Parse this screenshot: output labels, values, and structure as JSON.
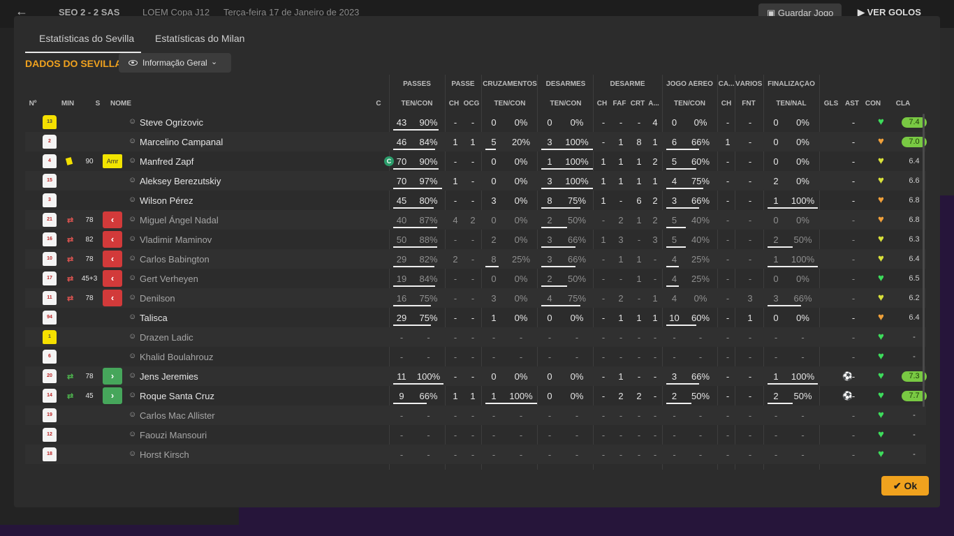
{
  "topbar": {
    "score": "SEO  2 - 2  SAS",
    "competition": "LOEM Copa J12",
    "date": "Terça-feira 17 de Janeiro de 2023",
    "save_label": "Guardar Jogo",
    "goals_label": "VER GOLOS"
  },
  "tabs": [
    {
      "label": "Estatísticas do Sevilla"
    },
    {
      "label": "Estatísticas do Milan"
    }
  ],
  "section": {
    "title": "DADOS DO SEVILLA",
    "filter": "Informação Geral"
  },
  "groups": [
    "PASSES",
    "PASSE",
    "CRUZAMENTOS",
    "DESARMES",
    "DESARME",
    "JOGO AÉREO",
    "CA...",
    "VÁRIOS",
    "FINALIZAÇÃO"
  ],
  "columns": [
    "Nº",
    "MIN",
    "S",
    "NOME",
    "C",
    "TEN/CON",
    "CH",
    "OCG",
    "TEN/CON",
    "TEN/CON",
    "CH",
    "FAF",
    "CRT",
    "A...",
    "TEN/CON",
    "CH",
    "FNT",
    "TEN/NAL",
    "GLS",
    "AST",
    "CON",
    "CLA"
  ],
  "players": [
    {
      "num": "13",
      "kit": "y",
      "min": "",
      "sub": "",
      "pos": "",
      "card": false,
      "capt": false,
      "name": "Steve Ogrizovic",
      "dim": false,
      "p_ten": "43",
      "p_pct": "90%",
      "pb": 90,
      "pa_ch": "-",
      "pa_ocg": "-",
      "cr_ten": "0",
      "cr_pct": "0%",
      "crb": 0,
      "de_ten": "0",
      "de_pct": "0%",
      "deb": 0,
      "ds_ch": "-",
      "ds_faf": "-",
      "ds_crt": "-",
      "ds_a": "4",
      "ja_ten": "0",
      "ja_pct": "0%",
      "jab": 0,
      "ca_ch": "-",
      "fnt": "-",
      "fi_ten": "0",
      "fi_pct": "0%",
      "fib": 0,
      "gls": "",
      "ast": "-",
      "con": "green",
      "cla": "7.4",
      "cla_hi": true
    },
    {
      "num": "2",
      "kit": "w",
      "min": "",
      "sub": "",
      "pos": "",
      "card": false,
      "capt": false,
      "name": "Marcelino Campanal",
      "dim": false,
      "p_ten": "46",
      "p_pct": "84%",
      "pb": 84,
      "pa_ch": "1",
      "pa_ocg": "1",
      "cr_ten": "5",
      "cr_pct": "20%",
      "crb": 20,
      "de_ten": "3",
      "de_pct": "100%",
      "deb": 100,
      "ds_ch": "-",
      "ds_faf": "1",
      "ds_crt": "8",
      "ds_a": "1",
      "ja_ten": "6",
      "ja_pct": "66%",
      "jab": 66,
      "ca_ch": "1",
      "fnt": "-",
      "fi_ten": "0",
      "fi_pct": "0%",
      "fib": 0,
      "gls": "",
      "ast": "-",
      "con": "orange",
      "cla": "7.0",
      "cla_hi": true
    },
    {
      "num": "4",
      "kit": "w",
      "min": "90",
      "sub": "",
      "pos": "Amr",
      "card": true,
      "capt": true,
      "name": "Manfred Zapf",
      "dim": false,
      "p_ten": "70",
      "p_pct": "90%",
      "pb": 90,
      "pa_ch": "-",
      "pa_ocg": "-",
      "cr_ten": "0",
      "cr_pct": "0%",
      "crb": 0,
      "de_ten": "1",
      "de_pct": "100%",
      "deb": 100,
      "ds_ch": "1",
      "ds_faf": "1",
      "ds_crt": "1",
      "ds_a": "2",
      "ja_ten": "5",
      "ja_pct": "60%",
      "jab": 60,
      "ca_ch": "-",
      "fnt": "-",
      "fi_ten": "0",
      "fi_pct": "0%",
      "fib": 0,
      "gls": "",
      "ast": "-",
      "con": "yellow",
      "cla": "6.4",
      "cla_hi": false
    },
    {
      "num": "15",
      "kit": "w",
      "min": "",
      "sub": "",
      "pos": "",
      "card": false,
      "capt": false,
      "name": "Aleksey Berezutskiy",
      "dim": false,
      "p_ten": "70",
      "p_pct": "97%",
      "pb": 97,
      "pa_ch": "1",
      "pa_ocg": "-",
      "cr_ten": "0",
      "cr_pct": "0%",
      "crb": 0,
      "de_ten": "3",
      "de_pct": "100%",
      "deb": 100,
      "ds_ch": "1",
      "ds_faf": "1",
      "ds_crt": "1",
      "ds_a": "1",
      "ja_ten": "4",
      "ja_pct": "75%",
      "jab": 75,
      "ca_ch": "-",
      "fnt": "-",
      "fi_ten": "2",
      "fi_pct": "0%",
      "fib": 0,
      "gls": "",
      "ast": "-",
      "con": "yellow",
      "cla": "6.6",
      "cla_hi": false
    },
    {
      "num": "3",
      "kit": "w",
      "min": "",
      "sub": "",
      "pos": "",
      "card": false,
      "capt": false,
      "name": "Wilson Pérez",
      "dim": false,
      "p_ten": "45",
      "p_pct": "80%",
      "pb": 80,
      "pa_ch": "-",
      "pa_ocg": "-",
      "cr_ten": "3",
      "cr_pct": "0%",
      "crb": 0,
      "de_ten": "8",
      "de_pct": "75%",
      "deb": 75,
      "ds_ch": "1",
      "ds_faf": "-",
      "ds_crt": "6",
      "ds_a": "2",
      "ja_ten": "3",
      "ja_pct": "66%",
      "jab": 66,
      "ca_ch": "-",
      "fnt": "-",
      "fi_ten": "1",
      "fi_pct": "100%",
      "fib": 100,
      "gls": "",
      "ast": "-",
      "con": "orange",
      "cla": "6.8",
      "cla_hi": false
    },
    {
      "num": "21",
      "kit": "w",
      "min": "78",
      "sub": "out",
      "pos": "",
      "card": false,
      "capt": false,
      "name": "Miguel Ángel Nadal",
      "dim": true,
      "p_ten": "40",
      "p_pct": "87%",
      "pb": 87,
      "pa_ch": "4",
      "pa_ocg": "2",
      "cr_ten": "0",
      "cr_pct": "0%",
      "crb": 0,
      "de_ten": "2",
      "de_pct": "50%",
      "deb": 50,
      "ds_ch": "-",
      "ds_faf": "2",
      "ds_crt": "1",
      "ds_a": "2",
      "ja_ten": "5",
      "ja_pct": "40%",
      "jab": 40,
      "ca_ch": "-",
      "fnt": "-",
      "fi_ten": "0",
      "fi_pct": "0%",
      "fib": 0,
      "gls": "",
      "ast": "-",
      "con": "orange",
      "cla": "6.8",
      "cla_hi": false
    },
    {
      "num": "16",
      "kit": "w",
      "min": "82",
      "sub": "out",
      "pos": "",
      "card": false,
      "capt": false,
      "name": "Vladimir Maminov",
      "dim": true,
      "p_ten": "50",
      "p_pct": "88%",
      "pb": 88,
      "pa_ch": "-",
      "pa_ocg": "-",
      "cr_ten": "2",
      "cr_pct": "0%",
      "crb": 0,
      "de_ten": "3",
      "de_pct": "66%",
      "deb": 66,
      "ds_ch": "1",
      "ds_faf": "3",
      "ds_crt": "-",
      "ds_a": "3",
      "ja_ten": "5",
      "ja_pct": "40%",
      "jab": 40,
      "ca_ch": "-",
      "fnt": "-",
      "fi_ten": "2",
      "fi_pct": "50%",
      "fib": 50,
      "gls": "",
      "ast": "-",
      "con": "yellow",
      "cla": "6.3",
      "cla_hi": false
    },
    {
      "num": "10",
      "kit": "w",
      "min": "78",
      "sub": "out",
      "pos": "",
      "card": false,
      "capt": false,
      "name": "Carlos Babington",
      "dim": true,
      "p_ten": "29",
      "p_pct": "82%",
      "pb": 82,
      "pa_ch": "2",
      "pa_ocg": "-",
      "cr_ten": "8",
      "cr_pct": "25%",
      "crb": 25,
      "de_ten": "3",
      "de_pct": "66%",
      "deb": 66,
      "ds_ch": "-",
      "ds_faf": "1",
      "ds_crt": "1",
      "ds_a": "-",
      "ja_ten": "4",
      "ja_pct": "25%",
      "jab": 25,
      "ca_ch": "-",
      "fnt": "-",
      "fi_ten": "1",
      "fi_pct": "100%",
      "fib": 100,
      "gls": "",
      "ast": "-",
      "con": "yellow",
      "cla": "6.4",
      "cla_hi": false
    },
    {
      "num": "17",
      "kit": "w",
      "min": "45+3",
      "sub": "out",
      "pos": "",
      "card": false,
      "capt": false,
      "name": "Gert Verheyen",
      "dim": true,
      "p_ten": "19",
      "p_pct": "84%",
      "pb": 84,
      "pa_ch": "-",
      "pa_ocg": "-",
      "cr_ten": "0",
      "cr_pct": "0%",
      "crb": 0,
      "de_ten": "2",
      "de_pct": "50%",
      "deb": 50,
      "ds_ch": "-",
      "ds_faf": "-",
      "ds_crt": "1",
      "ds_a": "-",
      "ja_ten": "4",
      "ja_pct": "25%",
      "jab": 25,
      "ca_ch": "-",
      "fnt": "-",
      "fi_ten": "0",
      "fi_pct": "0%",
      "fib": 0,
      "gls": "",
      "ast": "-",
      "con": "green",
      "cla": "6.5",
      "cla_hi": false
    },
    {
      "num": "11",
      "kit": "w",
      "min": "78",
      "sub": "out",
      "pos": "",
      "card": false,
      "capt": false,
      "name": "Denilson",
      "dim": true,
      "p_ten": "16",
      "p_pct": "75%",
      "pb": 75,
      "pa_ch": "-",
      "pa_ocg": "-",
      "cr_ten": "3",
      "cr_pct": "0%",
      "crb": 0,
      "de_ten": "4",
      "de_pct": "75%",
      "deb": 75,
      "ds_ch": "-",
      "ds_faf": "2",
      "ds_crt": "-",
      "ds_a": "1",
      "ja_ten": "4",
      "ja_pct": "0%",
      "jab": 0,
      "ca_ch": "-",
      "fnt": "3",
      "fi_ten": "3",
      "fi_pct": "66%",
      "fib": 66,
      "gls": "",
      "ast": "-",
      "con": "yellow",
      "cla": "6.2",
      "cla_hi": false
    },
    {
      "num": "94",
      "kit": "w",
      "min": "",
      "sub": "",
      "pos": "",
      "card": false,
      "capt": false,
      "name": "Talisca",
      "dim": false,
      "p_ten": "29",
      "p_pct": "75%",
      "pb": 75,
      "pa_ch": "-",
      "pa_ocg": "-",
      "cr_ten": "1",
      "cr_pct": "0%",
      "crb": 0,
      "de_ten": "0",
      "de_pct": "0%",
      "deb": 0,
      "ds_ch": "-",
      "ds_faf": "1",
      "ds_crt": "1",
      "ds_a": "1",
      "ja_ten": "10",
      "ja_pct": "60%",
      "jab": 60,
      "ca_ch": "-",
      "fnt": "1",
      "fi_ten": "0",
      "fi_pct": "0%",
      "fib": 0,
      "gls": "",
      "ast": "-",
      "con": "orange",
      "cla": "6.4",
      "cla_hi": false
    },
    {
      "num": "1",
      "kit": "y",
      "min": "",
      "sub": "",
      "pos": "",
      "card": false,
      "capt": false,
      "name": "Drazen Ladic",
      "dim": true,
      "p_ten": "-",
      "p_pct": "-",
      "pb": 0,
      "pa_ch": "-",
      "pa_ocg": "-",
      "cr_ten": "-",
      "cr_pct": "-",
      "crb": 0,
      "de_ten": "-",
      "de_pct": "-",
      "deb": 0,
      "ds_ch": "-",
      "ds_faf": "-",
      "ds_crt": "-",
      "ds_a": "-",
      "ja_ten": "-",
      "ja_pct": "-",
      "jab": 0,
      "ca_ch": "-",
      "fnt": "-",
      "fi_ten": "-",
      "fi_pct": "-",
      "fib": 0,
      "gls": "",
      "ast": "-",
      "con": "green",
      "cla": "-",
      "cla_hi": false
    },
    {
      "num": "6",
      "kit": "w",
      "min": "",
      "sub": "",
      "pos": "",
      "card": false,
      "capt": false,
      "name": "Khalid Boulahrouz",
      "dim": true,
      "p_ten": "-",
      "p_pct": "-",
      "pb": 0,
      "pa_ch": "-",
      "pa_ocg": "-",
      "cr_ten": "-",
      "cr_pct": "-",
      "crb": 0,
      "de_ten": "-",
      "de_pct": "-",
      "deb": 0,
      "ds_ch": "-",
      "ds_faf": "-",
      "ds_crt": "-",
      "ds_a": "-",
      "ja_ten": "-",
      "ja_pct": "-",
      "jab": 0,
      "ca_ch": "-",
      "fnt": "-",
      "fi_ten": "-",
      "fi_pct": "-",
      "fib": 0,
      "gls": "",
      "ast": "-",
      "con": "green",
      "cla": "-",
      "cla_hi": false
    },
    {
      "num": "20",
      "kit": "w",
      "min": "78",
      "sub": "in",
      "pos": "",
      "card": false,
      "capt": false,
      "name": "Jens Jeremies",
      "dim": false,
      "p_ten": "11",
      "p_pct": "100%",
      "pb": 100,
      "pa_ch": "-",
      "pa_ocg": "-",
      "cr_ten": "0",
      "cr_pct": "0%",
      "crb": 0,
      "de_ten": "0",
      "de_pct": "0%",
      "deb": 0,
      "ds_ch": "-",
      "ds_faf": "1",
      "ds_crt": "-",
      "ds_a": "-",
      "ja_ten": "3",
      "ja_pct": "66%",
      "jab": 66,
      "ca_ch": "-",
      "fnt": "-",
      "fi_ten": "1",
      "fi_pct": "100%",
      "fib": 100,
      "gls": "ball",
      "ast": "-",
      "con": "green",
      "cla": "7.3",
      "cla_hi": true
    },
    {
      "num": "14",
      "kit": "w",
      "min": "45",
      "sub": "in",
      "pos": "",
      "card": false,
      "capt": false,
      "name": "Roque Santa Cruz",
      "dim": false,
      "p_ten": "9",
      "p_pct": "66%",
      "pb": 66,
      "pa_ch": "1",
      "pa_ocg": "1",
      "cr_ten": "1",
      "cr_pct": "100%",
      "crb": 100,
      "de_ten": "0",
      "de_pct": "0%",
      "deb": 0,
      "ds_ch": "-",
      "ds_faf": "2",
      "ds_crt": "2",
      "ds_a": "-",
      "ja_ten": "2",
      "ja_pct": "50%",
      "jab": 50,
      "ca_ch": "-",
      "fnt": "-",
      "fi_ten": "2",
      "fi_pct": "50%",
      "fib": 50,
      "gls": "ball",
      "ast": "-",
      "con": "green",
      "cla": "7.7",
      "cla_hi": true
    },
    {
      "num": "19",
      "kit": "w",
      "min": "",
      "sub": "",
      "pos": "",
      "card": false,
      "capt": false,
      "name": "Carlos Mac Allister",
      "dim": true,
      "p_ten": "-",
      "p_pct": "-",
      "pb": 0,
      "pa_ch": "-",
      "pa_ocg": "-",
      "cr_ten": "-",
      "cr_pct": "-",
      "crb": 0,
      "de_ten": "-",
      "de_pct": "-",
      "deb": 0,
      "ds_ch": "-",
      "ds_faf": "-",
      "ds_crt": "-",
      "ds_a": "-",
      "ja_ten": "-",
      "ja_pct": "-",
      "jab": 0,
      "ca_ch": "-",
      "fnt": "-",
      "fi_ten": "-",
      "fi_pct": "-",
      "fib": 0,
      "gls": "",
      "ast": "-",
      "con": "green",
      "cla": "-",
      "cla_hi": false
    },
    {
      "num": "12",
      "kit": "w",
      "min": "",
      "sub": "",
      "pos": "",
      "card": false,
      "capt": false,
      "name": "Faouzi Mansouri",
      "dim": true,
      "p_ten": "-",
      "p_pct": "-",
      "pb": 0,
      "pa_ch": "-",
      "pa_ocg": "-",
      "cr_ten": "-",
      "cr_pct": "-",
      "crb": 0,
      "de_ten": "-",
      "de_pct": "-",
      "deb": 0,
      "ds_ch": "-",
      "ds_faf": "-",
      "ds_crt": "-",
      "ds_a": "-",
      "ja_ten": "-",
      "ja_pct": "-",
      "jab": 0,
      "ca_ch": "-",
      "fnt": "-",
      "fi_ten": "-",
      "fi_pct": "-",
      "fib": 0,
      "gls": "",
      "ast": "-",
      "con": "green",
      "cla": "-",
      "cla_hi": false
    },
    {
      "num": "18",
      "kit": "w",
      "min": "",
      "sub": "",
      "pos": "",
      "card": false,
      "capt": false,
      "name": "Horst Kirsch",
      "dim": true,
      "p_ten": "-",
      "p_pct": "-",
      "pb": 0,
      "pa_ch": "-",
      "pa_ocg": "-",
      "cr_ten": "-",
      "cr_pct": "-",
      "crb": 0,
      "de_ten": "-",
      "de_pct": "-",
      "deb": 0,
      "ds_ch": "-",
      "ds_faf": "-",
      "ds_crt": "-",
      "ds_a": "-",
      "ja_ten": "-",
      "ja_pct": "-",
      "jab": 0,
      "ca_ch": "-",
      "fnt": "-",
      "fi_ten": "-",
      "fi_pct": "-",
      "fib": 0,
      "gls": "",
      "ast": "-",
      "con": "green",
      "cla": "-",
      "cla_hi": false
    }
  ],
  "ok_label": "Ok",
  "colors": {
    "accent": "#f0a21e",
    "rating_high": "#79c943",
    "sub_out": "#d23a3a",
    "sub_in": "#46a65b",
    "heart_green": "#3ddc5b",
    "heart_yellow": "#d8e03a",
    "heart_orange": "#f0a03a"
  }
}
